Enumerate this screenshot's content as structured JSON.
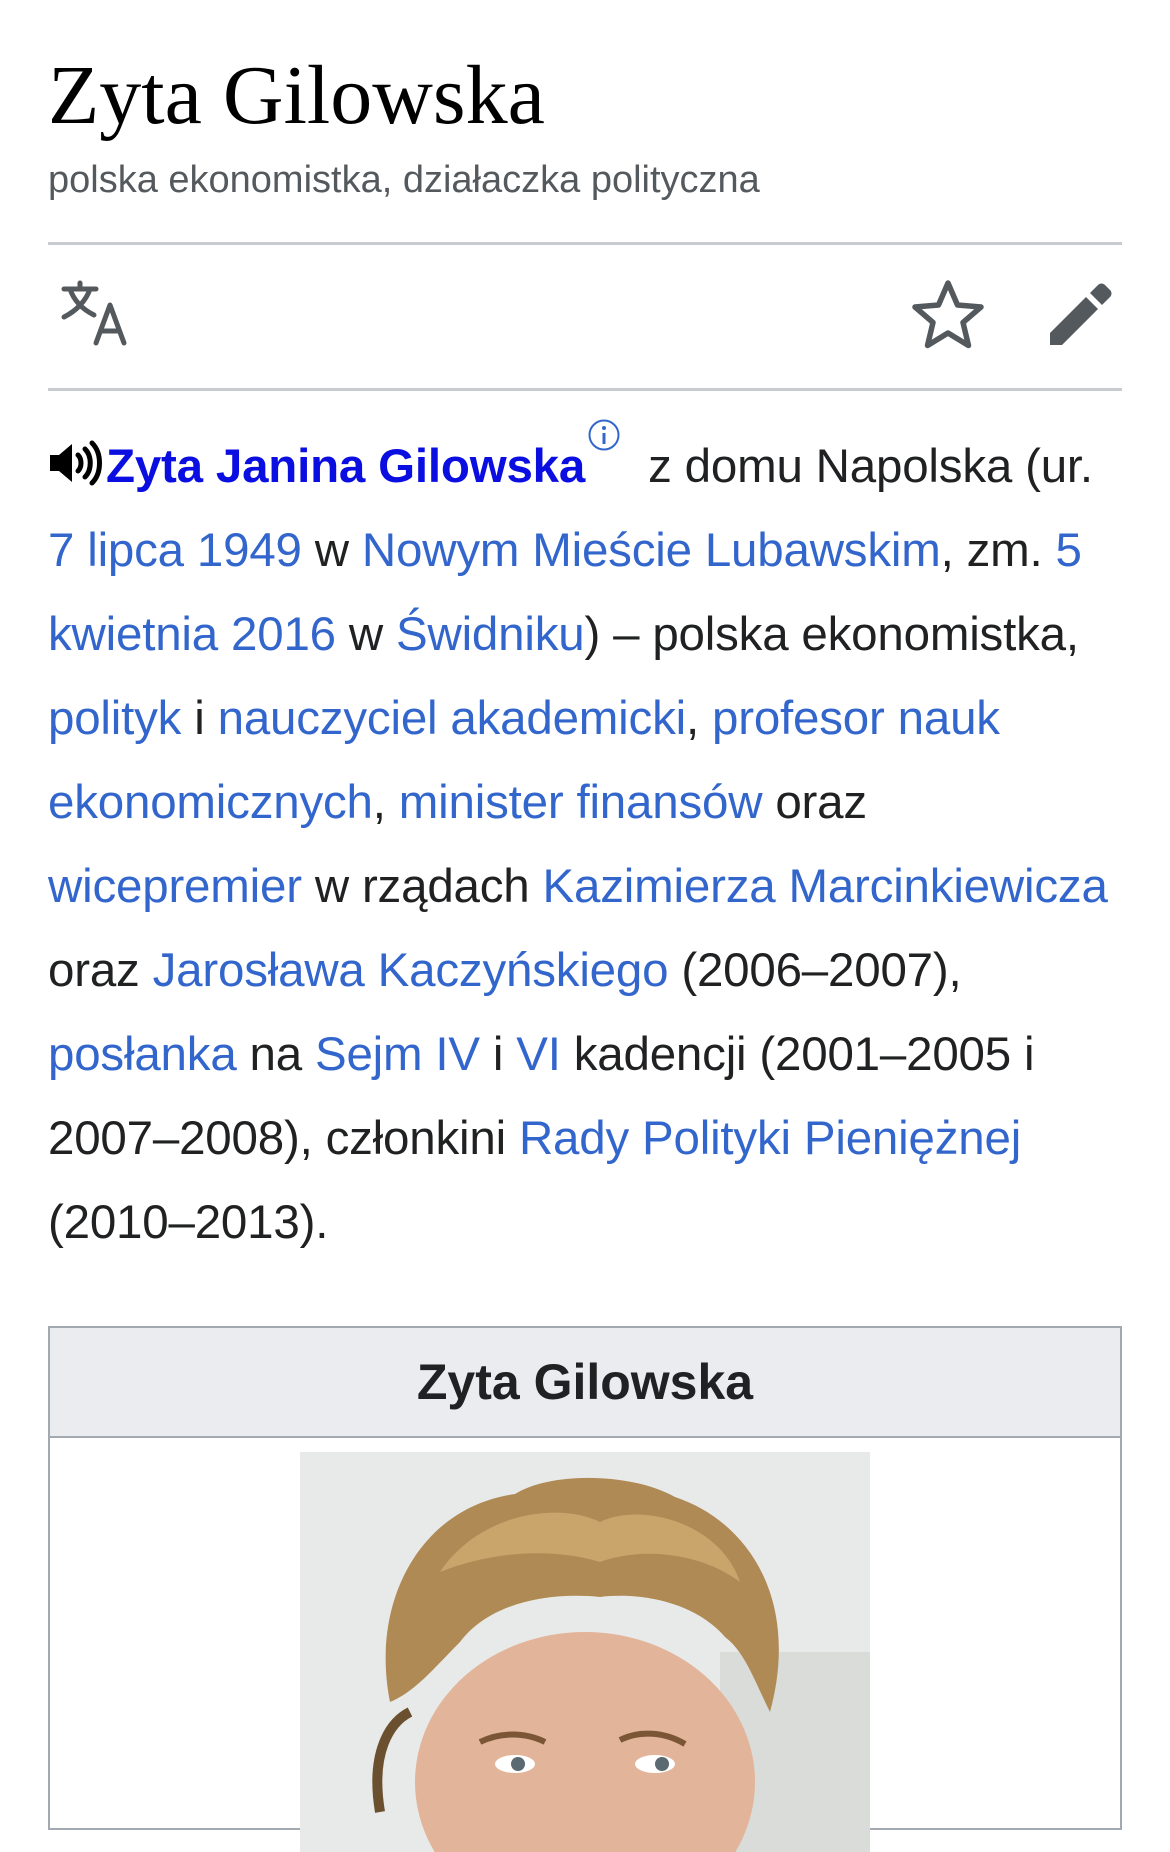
{
  "page": {
    "title": "Zyta Gilowska",
    "description": "polska ekonomistka, działaczka polityczna"
  },
  "toolbar": {
    "language_icon": "translate-icon",
    "watch_icon": "star-icon",
    "edit_icon": "pencil-icon"
  },
  "lead": {
    "audio_icon": "speaker-icon",
    "name": "Zyta Janina Gilowska",
    "info_icon": "info-icon",
    "t1": " z domu Napolska (ur. ",
    "birth_date": "7 lipca 1949",
    "t2": " w ",
    "birth_place": "Nowym Mieście Lubawskim",
    "t3": ", zm. ",
    "death_date": "5 kwietnia 2016",
    "t4": " w ",
    "death_place": "Świdniku",
    "t5": ") – polska ekonomistka, ",
    "link_polityk": "polityk",
    "t6": " i ",
    "link_nauczyciel": "nauczyciel akademicki",
    "t7": ", ",
    "link_profesor": "profesor nauk ekonomicznych",
    "t8": ", ",
    "link_minister": "minister finansów",
    "t9": " oraz ",
    "link_wicepremier": "wicepremier",
    "t10": " w rządach ",
    "link_marcinkiewicz": "Kazimierza Marcinkiewicza",
    "t11": " oraz ",
    "link_kaczynski": "Jarosława Kaczyńskiego",
    "t12": " (2006–2007), ",
    "link_poslanka": "posłanka",
    "t13": " na ",
    "link_sejm_iv": "Sejm IV",
    "t14": " i ",
    "link_vi": "VI",
    "t15": " kadencji (2001–2005 i 2007–2008), członkini ",
    "link_rpp": "Rady Polityki Pieniężnej",
    "t16": " (2010–2013)."
  },
  "infobox": {
    "title": "Zyta Gilowska"
  },
  "colors": {
    "link": "#3366cc",
    "bold_link": "#0b0ee0",
    "text": "#202122",
    "muted": "#54595d",
    "border": "#c8ccd1"
  }
}
